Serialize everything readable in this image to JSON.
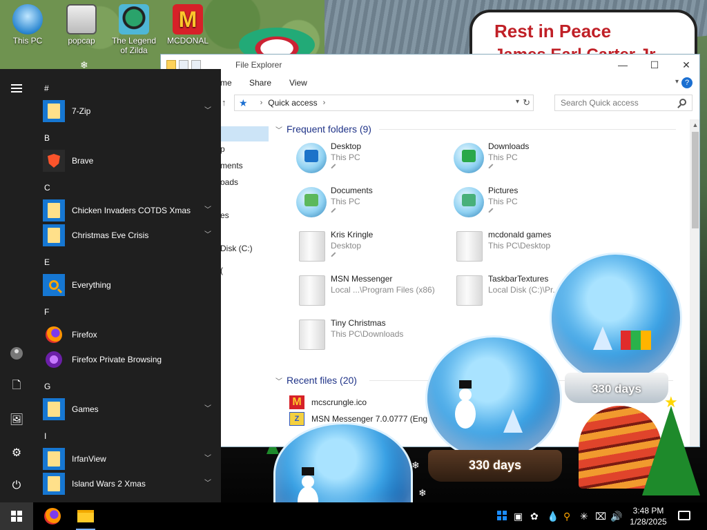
{
  "desktop": {
    "icons": [
      {
        "label": "This PC",
        "icon": "computer-icon"
      },
      {
        "label": "popcap",
        "icon": "popcap-icon"
      },
      {
        "label": "The Legend of Zilda",
        "icon": "zilda-game-icon"
      },
      {
        "label": "MCDONAL",
        "icon": "mcdonalds-icon"
      }
    ],
    "wallpaper_text": {
      "title": "Rest in Peace",
      "subtitle": "James Earl Carter Jr"
    },
    "globe_days_small": "330 days",
    "globe_days_large": "330 days"
  },
  "start_menu": {
    "rail": {
      "user": "user-avatar",
      "documents": "documents-icon",
      "pictures": "pictures-icon",
      "settings": "settings-icon",
      "power": "power-icon"
    },
    "letters": {
      "hash": "#",
      "b": "B",
      "c": "C",
      "e": "E",
      "f": "F",
      "g": "G",
      "i": "I"
    },
    "apps": [
      {
        "label": "7-Zip",
        "tile": "folder",
        "expandable": true
      },
      {
        "label": "Brave",
        "tile": "brave",
        "expandable": false
      },
      {
        "label": "Chicken Invaders COTDS Xmas",
        "tile": "folder",
        "expandable": true
      },
      {
        "label": "Christmas Eve Crisis",
        "tile": "folder",
        "expandable": true
      },
      {
        "label": "Everything",
        "tile": "everything",
        "expandable": false
      },
      {
        "label": "Firefox",
        "tile": "firefox",
        "expandable": false
      },
      {
        "label": "Firefox Private Browsing",
        "tile": "firefox-private",
        "expandable": false
      },
      {
        "label": "Games",
        "tile": "folder",
        "expandable": true
      },
      {
        "label": "IrfanView",
        "tile": "folder",
        "expandable": true
      },
      {
        "label": "Island Wars 2 Xmas",
        "tile": "folder",
        "expandable": true
      }
    ]
  },
  "explorer": {
    "title": "File Explorer",
    "ribbon": {
      "tab_home": "me",
      "tab_share": "Share",
      "tab_view": "View",
      "help": "?"
    },
    "address": {
      "location": "Quick access"
    },
    "search_placeholder": "Search Quick access",
    "nav_pane": [
      "p",
      "ments",
      "oads",
      "es",
      "Disk (C:)",
      "("
    ],
    "frequent": {
      "header": "Frequent folders (9)",
      "items": [
        {
          "name": "Desktop",
          "location": "This PC",
          "pinned": true,
          "color": "#1c73c9"
        },
        {
          "name": "Downloads",
          "location": "This PC",
          "pinned": true,
          "color": "#2aa84a"
        },
        {
          "name": "Documents",
          "location": "This PC",
          "pinned": true,
          "color": "#5cb85c"
        },
        {
          "name": "Pictures",
          "location": "This PC",
          "pinned": true,
          "color": "#48b07a"
        },
        {
          "name": "Kris Kringle",
          "location": "Desktop",
          "pinned": true
        },
        {
          "name": "mcdonald games",
          "location": "This PC\\Desktop",
          "pinned": false
        },
        {
          "name": "MSN Messenger",
          "location": "Local ...\\Program Files (x86)",
          "pinned": false
        },
        {
          "name": "TaskbarTextures",
          "location": "Local Disk (C:)\\Pr...",
          "pinned": false
        },
        {
          "name": "Tiny Christmas",
          "location": "This PC\\Downloads",
          "pinned": false
        }
      ]
    },
    "recent": {
      "header": "Recent files (20)",
      "items": [
        {
          "name": "mcscrungle.ico",
          "icon": "mcdonalds-icon"
        },
        {
          "name": "MSN Messenger 7.0.0777 (Eng",
          "icon": "msn-installer-icon"
        }
      ]
    }
  },
  "taskbar": {
    "pinned": [
      {
        "name": "Firefox",
        "active": false
      },
      {
        "name": "File Explorer",
        "active": true
      }
    ],
    "time": "3:48 PM",
    "date": "1/28/2025"
  }
}
